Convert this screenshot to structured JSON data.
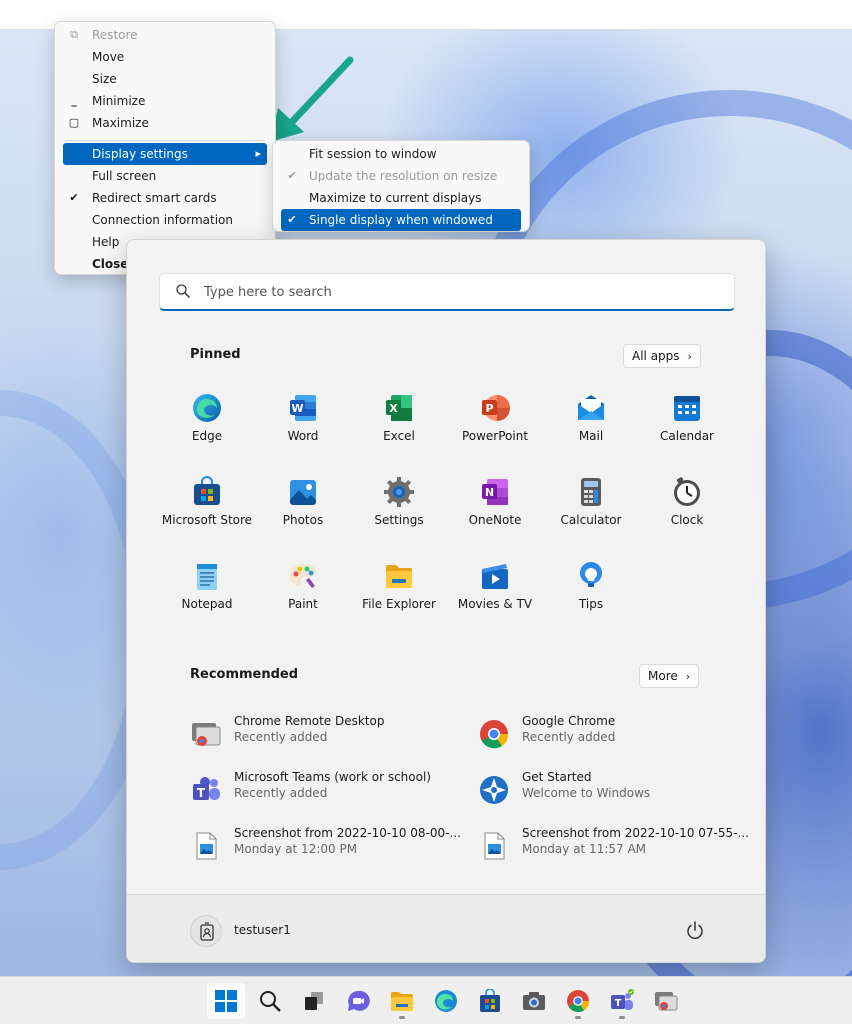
{
  "context_menu": {
    "items": [
      {
        "label": "Restore",
        "glyph": "restore-icon",
        "disabled": true
      },
      {
        "label": "Move"
      },
      {
        "label": "Size"
      },
      {
        "label": "Minimize",
        "glyph": "minimize-icon"
      },
      {
        "label": "Maximize",
        "glyph": "maximize-icon"
      },
      {
        "label": "Display settings",
        "highlighted": true,
        "submenu": true
      },
      {
        "label": "Full screen"
      },
      {
        "label": "Redirect smart cards",
        "checked": true
      },
      {
        "label": "Connection information"
      },
      {
        "label": "Help"
      },
      {
        "label": "Close",
        "bold": true
      }
    ]
  },
  "submenu": {
    "items": [
      {
        "label": "Fit session to window"
      },
      {
        "label": "Update the resolution on resize",
        "checked": true,
        "disabled": true
      },
      {
        "label": "Maximize to current displays"
      },
      {
        "label": "Single display when windowed",
        "checked": true,
        "highlighted": true
      }
    ]
  },
  "start_menu": {
    "search_placeholder": "Type here to search",
    "pinned_title": "Pinned",
    "all_apps_label": "All apps",
    "pinned": [
      {
        "label": "Edge",
        "icon": "edge-icon"
      },
      {
        "label": "Word",
        "icon": "word-icon"
      },
      {
        "label": "Excel",
        "icon": "excel-icon"
      },
      {
        "label": "PowerPoint",
        "icon": "powerpoint-icon"
      },
      {
        "label": "Mail",
        "icon": "mail-icon"
      },
      {
        "label": "Calendar",
        "icon": "calendar-icon"
      },
      {
        "label": "Microsoft Store",
        "icon": "store-icon"
      },
      {
        "label": "Photos",
        "icon": "photos-icon"
      },
      {
        "label": "Settings",
        "icon": "settings-icon"
      },
      {
        "label": "OneNote",
        "icon": "onenote-icon"
      },
      {
        "label": "Calculator",
        "icon": "calculator-icon"
      },
      {
        "label": "Clock",
        "icon": "clock-icon"
      },
      {
        "label": "Notepad",
        "icon": "notepad-icon"
      },
      {
        "label": "Paint",
        "icon": "paint-icon"
      },
      {
        "label": "File Explorer",
        "icon": "file-explorer-icon"
      },
      {
        "label": "Movies & TV",
        "icon": "movies-icon"
      },
      {
        "label": "Tips",
        "icon": "tips-icon"
      }
    ],
    "recommended_title": "Recommended",
    "more_label": "More",
    "recommended": [
      {
        "title": "Chrome Remote Desktop",
        "subtitle": "Recently added",
        "icon": "remote-desktop-icon"
      },
      {
        "title": "Google Chrome",
        "subtitle": "Recently added",
        "icon": "chrome-icon"
      },
      {
        "title": "Microsoft Teams (work or school)",
        "subtitle": "Recently added",
        "icon": "teams-icon"
      },
      {
        "title": "Get Started",
        "subtitle": "Welcome to Windows",
        "icon": "get-started-icon"
      },
      {
        "title": "Screenshot from 2022-10-10 08-00-...",
        "subtitle": "Monday at 12:00 PM",
        "icon": "image-file-icon"
      },
      {
        "title": "Screenshot from 2022-10-10 07-55-...",
        "subtitle": "Monday at 11:57 AM",
        "icon": "image-file-icon"
      }
    ],
    "user_name": "testuser1"
  },
  "taskbar": {
    "items": [
      "start-icon",
      "search-icon",
      "task-view-icon",
      "chat-icon",
      "file-explorer-icon",
      "edge-icon",
      "store-icon",
      "camera-icon",
      "chrome-icon",
      "teams-icon",
      "remote-desktop-icon"
    ]
  },
  "colors": {
    "accent": "#0067c0",
    "annotation_arrow": "#1aa58a"
  }
}
